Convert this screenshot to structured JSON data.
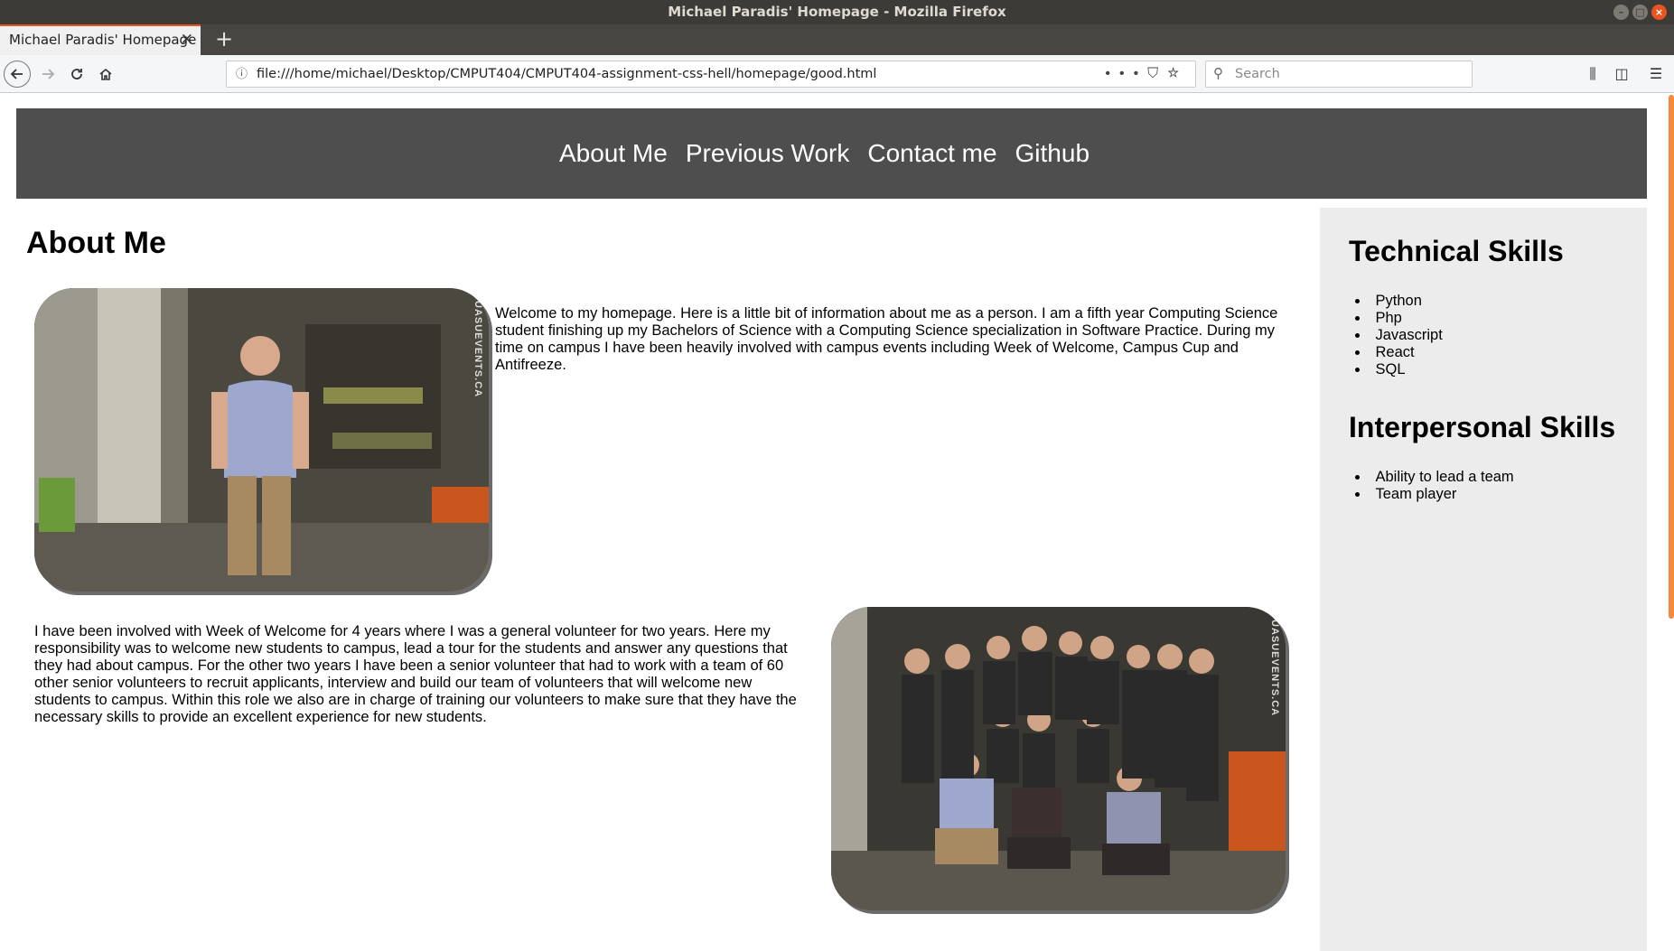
{
  "window": {
    "title": "Michael Paradis' Homepage - Mozilla Firefox"
  },
  "tab": {
    "label": "Michael Paradis' Homepage",
    "close": "✕",
    "new_tab": "+"
  },
  "toolbar": {
    "url": "file:///home/michael/Desktop/CMPUT404/CMPUT404-assignment-css-hell/homepage/good.html",
    "search_placeholder": "Search"
  },
  "site_nav": {
    "items": [
      "About Me",
      "Previous Work",
      "Contact me",
      "Github"
    ]
  },
  "main": {
    "heading": "About Me",
    "photo_watermark": "UASUEVENTS.CA",
    "paragraph1": "Welcome to my homepage. Here is a little bit of information about me as a person. I am a fifth year Computing Science student finishing up my Bachelors of Science with a Computing Science specialization in Software Practice. During my time on campus I have been heavily involved with campus events including Week of Welcome, Campus Cup and Antifreeze.",
    "paragraph2": "I have been involved with Week of Welcome for 4 years where I was a general volunteer for two years. Here my responsibility was to welcome new students to campus, lead a tour for the students and answer any questions that they had about campus. For the other two years I have been a senior volunteer that had to work with a team of 60 other senior volunteers to recruit applicants, interview and build our team of volunteers that will welcome new students to campus. Within this role we also are in charge of training our volunteers to make sure that they have the necessary skills to provide an excellent experience for new students."
  },
  "sidebar": {
    "technical_heading": "Technical Skills",
    "technical_skills": [
      "Python",
      "Php",
      "Javascript",
      "React",
      "SQL"
    ],
    "interpersonal_heading": "Interpersonal Skills",
    "interpersonal_skills": [
      "Ability to lead a team",
      "Team player"
    ]
  },
  "colors": {
    "accent": "#e95420",
    "nav_bg": "#4e4e4e",
    "sidebar_bg": "#ececec"
  }
}
